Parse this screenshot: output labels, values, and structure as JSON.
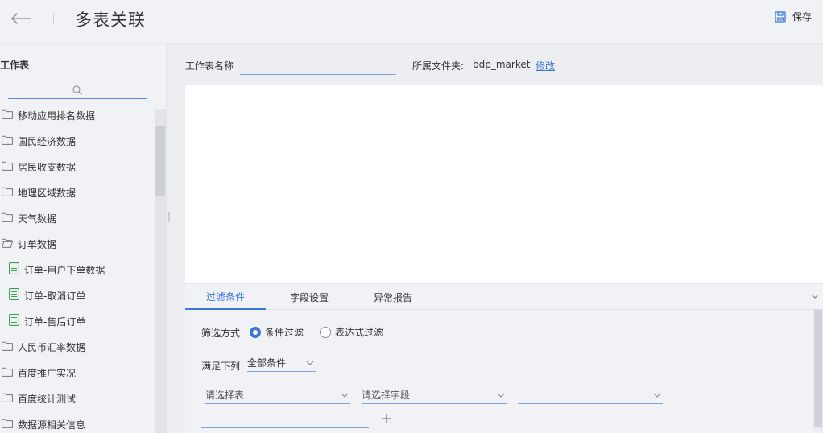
{
  "header": {
    "title": "多表关联",
    "save_label": "保存"
  },
  "sidebar": {
    "title": "工作表",
    "search_placeholder": "",
    "items": [
      {
        "type": "folder",
        "label": "移动应用排名数据"
      },
      {
        "type": "folder",
        "label": "国民经济数据"
      },
      {
        "type": "folder",
        "label": "居民收支数据"
      },
      {
        "type": "folder",
        "label": "地理区域数据"
      },
      {
        "type": "folder",
        "label": "天气数据"
      },
      {
        "type": "folder-open",
        "label": "订单数据"
      },
      {
        "type": "table",
        "label": "订单-用户下单数据"
      },
      {
        "type": "table",
        "label": "订单-取消订单"
      },
      {
        "type": "table",
        "label": "订单-售后订单"
      },
      {
        "type": "folder",
        "label": "人民币汇率数据"
      },
      {
        "type": "folder",
        "label": "百度推广实况"
      },
      {
        "type": "folder",
        "label": "百度统计测试"
      },
      {
        "type": "folder",
        "label": "数据源相关信息"
      }
    ]
  },
  "main": {
    "name_label": "工作表名称",
    "name_value": "",
    "folder_label": "所属文件夹:",
    "folder_value": "bdp_market",
    "folder_edit": "修改"
  },
  "panel": {
    "tabs": [
      "过滤条件",
      "字段设置",
      "异常报告"
    ],
    "active_tab": 0,
    "filter_mode_label": "筛选方式",
    "filter_options": [
      "条件过滤",
      "表达式过滤"
    ],
    "filter_selected": 0,
    "match_label": "满足下列",
    "match_value": "全部条件",
    "table_select_placeholder": "请选择表",
    "field_select_placeholder": "请选择字段",
    "operator_select_value": ""
  },
  "colors": {
    "accent": "#3a78d6",
    "icon_green": "#3aa14a",
    "background": "#f1f2f5"
  }
}
